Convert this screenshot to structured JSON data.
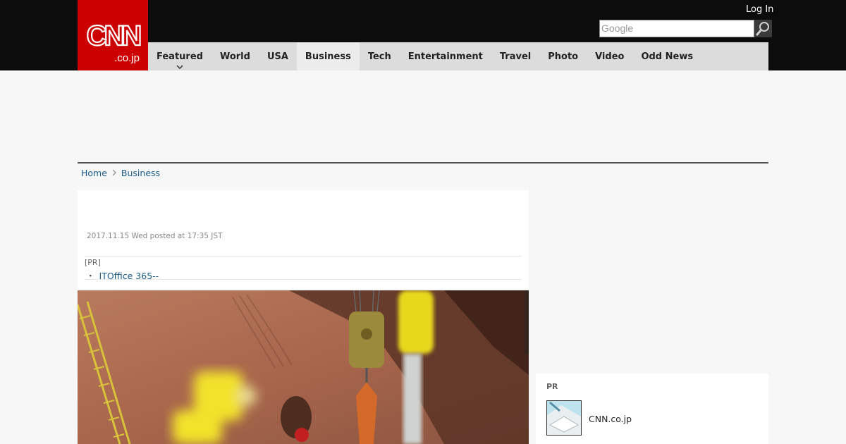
{
  "header": {
    "logo": {
      "line1": "CNN",
      "line2": ".co.jp",
      "color": "#cc0000"
    },
    "login_label": "Log In",
    "search": {
      "placeholder": "Google",
      "icon": "magnifier-icon"
    }
  },
  "nav": {
    "items": [
      {
        "label": "Featured",
        "has_dropdown": true
      },
      {
        "label": "World"
      },
      {
        "label": "USA"
      },
      {
        "label": "Business",
        "active": true
      },
      {
        "label": "Tech"
      },
      {
        "label": "Entertainment"
      },
      {
        "label": "Travel"
      },
      {
        "label": "Photo"
      },
      {
        "label": "Video"
      },
      {
        "label": "Odd News"
      }
    ]
  },
  "breadcrumb": {
    "home": "Home",
    "current": "Business"
  },
  "article": {
    "posted": "2017.11.15 Wed posted at 17:35 JST",
    "pr_tag": "[PR]",
    "pr_link": "ITOffice 365--"
  },
  "sidebar": {
    "pr_label": "PR",
    "link_text": "CNN.co.jp"
  },
  "colors": {
    "topbar": "#0c0c0c",
    "brand_red": "#cc0000",
    "nav_bg": "#dcdcdc",
    "link": "#1a5b8a"
  }
}
